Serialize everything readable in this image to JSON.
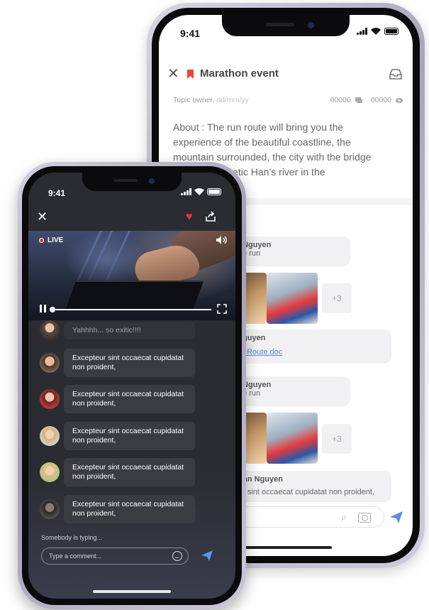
{
  "back_phone": {
    "status": {
      "time": "9:41"
    },
    "header": {
      "title": "Marathon event"
    },
    "meta": {
      "owner": "Topic owner,",
      "date": "dd/mm/yy",
      "comments_count": "00000",
      "views_count": "00000"
    },
    "about": "About : The run route will bring you the experience of the beautiful coastline, the mountain surrounded, the city with the bridge across the poetic Han’s river in the",
    "link_fragment": "s",
    "messages": [
      {
        "name": "Nguyen",
        "text": "e run"
      },
      {
        "more": "+3"
      },
      {
        "name": "guyen",
        "attachment": "eRoute.doc"
      },
      {
        "name": "Nguyen",
        "text": "e run"
      },
      {
        "more": "+3"
      },
      {
        "name": "Van Nguyen",
        "text": "ur sint occaecat cupidatat non proident,"
      }
    ],
    "accent": "#5a8be0"
  },
  "front_phone": {
    "status": {
      "time": "9:41"
    },
    "live_label": "LIVE",
    "comments": [
      {
        "text": "Yahhhh... so exitic!!!!"
      },
      {
        "text": "Excepteur sint occaecat cupidatat non proident,"
      },
      {
        "text": "Excepteur sint occaecat cupidatat non proident,"
      },
      {
        "text": "Excepteur sint occaecat cupidatat non proident,"
      },
      {
        "text": "Excepteur sint occaecat cupidatat non proident,"
      },
      {
        "text": "Excepteur sint occaecat cupidatat non proident,"
      }
    ],
    "typing": "Somebody is typing...",
    "comment_placeholder": "Type a comment...",
    "heart_color": "#f0303a",
    "send_color": "#4a9fe8"
  }
}
